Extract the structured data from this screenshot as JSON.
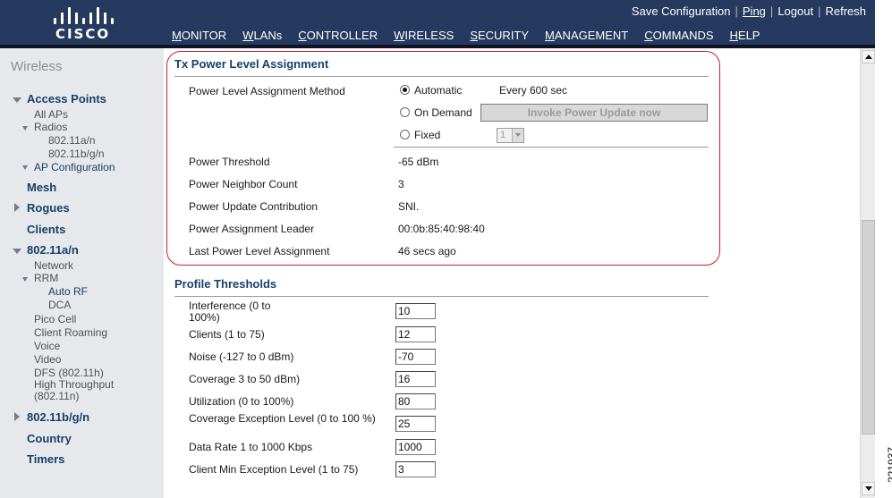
{
  "header": {
    "brand": "CISCO",
    "top_links": [
      "Save Configuration",
      "Ping",
      "Logout",
      "Refresh"
    ],
    "nav": [
      "MONITOR",
      "WLANs",
      "CONTROLLER",
      "WIRELESS",
      "SECURITY",
      "MANAGEMENT",
      "COMMANDS",
      "HELP"
    ],
    "active_nav": "WIRELESS",
    "accent_color": "#f0a030"
  },
  "sidebar": {
    "title": "Wireless",
    "access_points": "Access Points",
    "all_aps": "All APs",
    "radios": "Radios",
    "radio_a": "802.11a/n",
    "radio_bg": "802.11b/g/n",
    "ap_configuration": "AP Configuration",
    "mesh": "Mesh",
    "rogues": "Rogues",
    "clients": "Clients",
    "band_a": "802.11a/n",
    "network": "Network",
    "rrm": "RRM",
    "auto_rf": "Auto RF",
    "dca": "DCA",
    "pico_cell": "Pico Cell",
    "client_roaming": "Client Roaming",
    "voice": "Voice",
    "video": "Video",
    "dfs": "DFS (802.11h)",
    "high_throughput": "High Throughput (802.11n)",
    "band_bg": "802.11b/g/n",
    "country": "Country",
    "timers": "Timers"
  },
  "tx_power": {
    "title": "Tx Power Level Assignment",
    "method_label": "Power Level Assignment Method",
    "method_selected": "Automatic",
    "automatic_label": "Automatic",
    "automatic_interval": "Every 600 sec",
    "on_demand_label": "On Demand",
    "invoke_button": "Invoke Power Update now",
    "fixed_label": "Fixed",
    "fixed_value": "1",
    "rows": [
      {
        "label": "Power Threshold",
        "value": "-65 dBm"
      },
      {
        "label": "Power Neighbor Count",
        "value": "3"
      },
      {
        "label": "Power Update Contribution",
        "value": "SNI."
      },
      {
        "label": "Power Assignment Leader",
        "value": "00:0b:85:40:98:40"
      },
      {
        "label": "Last Power Level Assignment",
        "value": "46 secs ago"
      }
    ]
  },
  "profile_thresholds": {
    "title": "Profile Thresholds",
    "rows": [
      {
        "label": "Interference (0 to 100%)",
        "value": "10"
      },
      {
        "label": "Clients (1 to 75)",
        "value": "12"
      },
      {
        "label": "Noise (-127 to 0 dBm)",
        "value": "-70"
      },
      {
        "label": "Coverage 3 to 50 dBm)",
        "value": "16"
      },
      {
        "label": "Utilization (0 to 100%)",
        "value": "80"
      },
      {
        "label": "Coverage Exception Level (0 to 100 %)",
        "value": "25"
      },
      {
        "label": "Data Rate 1 to 1000 Kbps",
        "value": "1000"
      },
      {
        "label": "Client Min Exception Level (1 to 75)",
        "value": "3"
      }
    ]
  },
  "figure_id": "221937"
}
